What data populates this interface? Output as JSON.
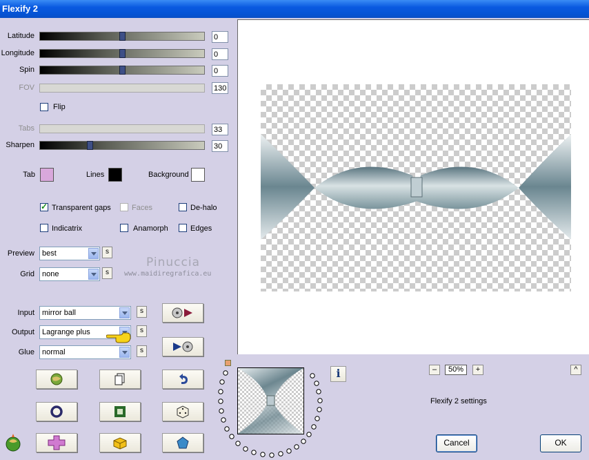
{
  "window": {
    "title": "Flexify 2"
  },
  "sliders": [
    {
      "label": "Latitude",
      "value": "0",
      "fraction": 0.5,
      "enabled": true
    },
    {
      "label": "Longitude",
      "value": "0",
      "fraction": 0.5,
      "enabled": true
    },
    {
      "label": "Spin",
      "value": "0",
      "fraction": 0.5,
      "enabled": true
    },
    {
      "label": "FOV",
      "value": "130",
      "enabled": false
    },
    {
      "label": "Tabs",
      "value": "33",
      "enabled": false
    },
    {
      "label": "Sharpen",
      "value": "30",
      "fraction": 0.3,
      "enabled": true
    }
  ],
  "flip": {
    "label": "Flip",
    "checked": false
  },
  "colors": {
    "tab": {
      "label": "Tab",
      "color": "#d9a8dc"
    },
    "lines": {
      "label": "Lines",
      "color": "#000000"
    },
    "background": {
      "label": "Background",
      "color": "#ffffff"
    }
  },
  "options": {
    "transparent_gaps": {
      "label": "Transparent gaps",
      "checked": true
    },
    "faces": {
      "label": "Faces",
      "checked": false,
      "enabled": false
    },
    "de_halo": {
      "label": "De-halo",
      "checked": false
    },
    "indicatrix": {
      "label": "Indicatrix",
      "checked": false
    },
    "anamorph": {
      "label": "Anamorph",
      "checked": false
    },
    "edges": {
      "label": "Edges",
      "checked": false
    }
  },
  "preview_select": {
    "label": "Preview",
    "value": "best",
    "s_label": "s"
  },
  "grid_select": {
    "label": "Grid",
    "value": "none",
    "s_label": "s"
  },
  "watermark": {
    "name": "Pinuccia",
    "url": "www.maidiregrafica.eu"
  },
  "input_select": {
    "label": "Input",
    "value": "mirror ball",
    "s_label": "s"
  },
  "output_select": {
    "label": "Output",
    "value": "Lagrange plus",
    "s_label": "s"
  },
  "glue_select": {
    "label": "Glue",
    "value": "normal",
    "s_label": "s"
  },
  "zoom": {
    "minus": "–",
    "value": "50%",
    "plus": "+"
  },
  "info_label": "i",
  "caret_label": "^",
  "settings_text": "Flexify 2 settings",
  "buttons": {
    "cancel": "Cancel",
    "ok": "OK"
  }
}
